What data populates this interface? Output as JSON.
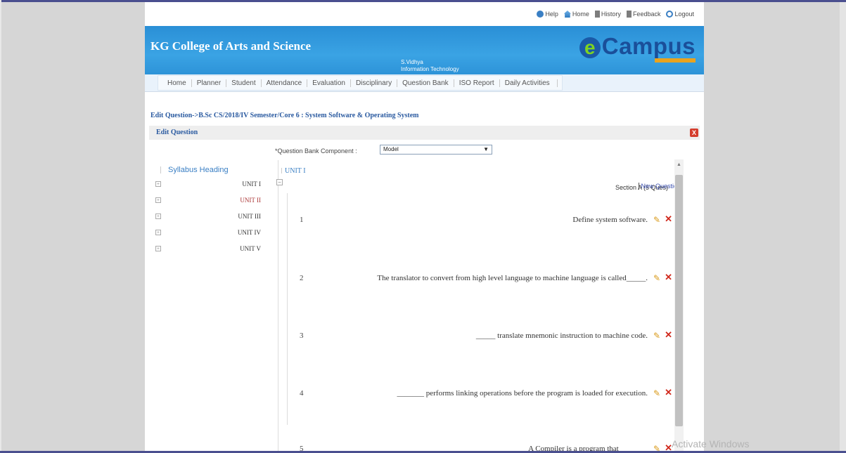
{
  "toplinks": [
    {
      "label": "Help",
      "icon": "help-icon"
    },
    {
      "label": "Home",
      "icon": "home-icon"
    },
    {
      "label": "History",
      "icon": "history-icon"
    },
    {
      "label": "Feedback",
      "icon": "feedback-icon"
    },
    {
      "label": "Logout",
      "icon": "logout-icon"
    }
  ],
  "header": {
    "college_name": "KG College of Arts and Science",
    "user_name": "S.Vidhya",
    "department": "Information Technology",
    "logo_letter": "e",
    "logo_text": "Campus"
  },
  "nav": [
    "Home",
    "Planner",
    "Student",
    "Attendance",
    "Evaluation",
    "Disciplinary",
    "Question Bank",
    "ISO Report",
    "Daily Activities"
  ],
  "breadcrumb": "Edit Question->B.Sc CS/2018/IV Semester/Core 6 : System Software & Operating System",
  "panel": {
    "title": "Edit Question",
    "close_label": "X"
  },
  "question_bank_component": {
    "label": "*Question Bank Component :",
    "selected": "Model"
  },
  "syllabus": {
    "heading": "Syllabus Heading",
    "units": [
      "UNIT I",
      "UNIT II",
      "UNIT III",
      "UNIT IV",
      "UNIT V"
    ]
  },
  "current_unit": "UNIT I",
  "section": {
    "info": "Section A (5 Ques)",
    "new_question_label": "New Question"
  },
  "questions": [
    {
      "num": "1",
      "text": "Define system software."
    },
    {
      "num": "2",
      "text": "The translator to convert from high level language to machine language is called_____."
    },
    {
      "num": "3",
      "text": "_____ translate mnemonic instruction to machine code."
    },
    {
      "num": "4",
      "text": "_______ performs linking operations before the program is loaded for execution."
    },
    {
      "num": "5",
      "text": "A Compiler is a program that _______"
    }
  ],
  "watermark": "Activate Windows",
  "colors": {
    "banner": "#2a8fd6",
    "link_blue": "#2a5aa0",
    "delete_red": "#d0281c",
    "edit_orange": "#d99a1a"
  }
}
